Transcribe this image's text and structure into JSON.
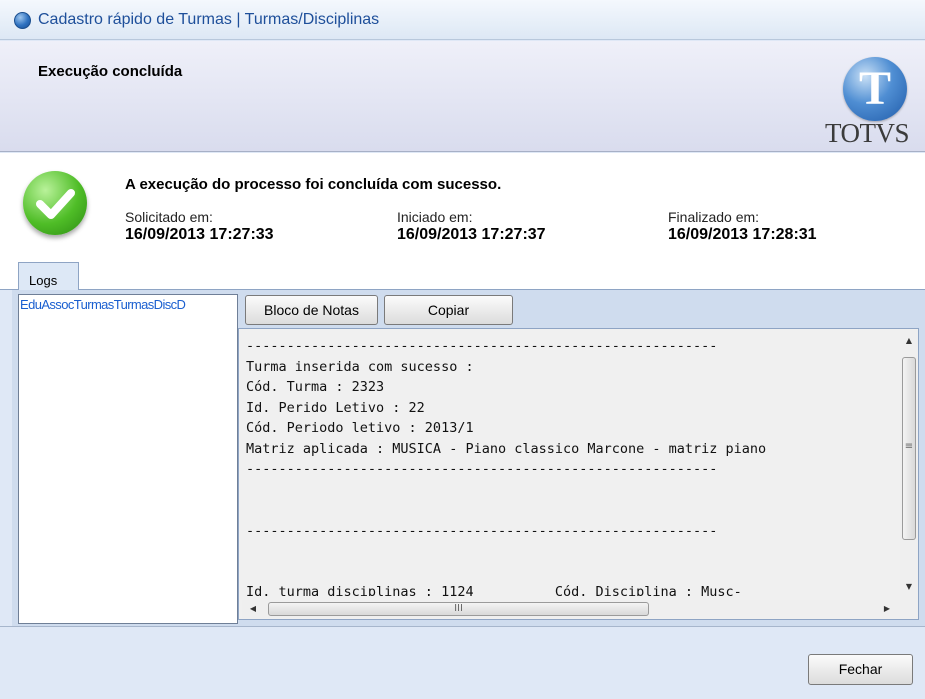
{
  "window": {
    "title": "Cadastro rápido de Turmas | Turmas/Disciplinas"
  },
  "header": {
    "title": "Execução concluída",
    "logo_text": "TOTVS",
    "logo_letter": "T"
  },
  "status": {
    "message": "A execução do processo foi concluída com sucesso.",
    "requested_label": "Solicitado em:",
    "requested_value": "16/09/2013 17:27:33",
    "started_label": "Iniciado em:",
    "started_value": "16/09/2013 17:27:37",
    "finished_label": "Finalizado em:",
    "finished_value": "16/09/2013 17:28:31"
  },
  "tabs": [
    {
      "label": "Logs"
    }
  ],
  "log_list": {
    "items": [
      "EduAssocTurmasTurmasDiscD"
    ]
  },
  "toolbar": {
    "notepad_label": "Bloco de Notas",
    "copy_label": "Copiar"
  },
  "log": {
    "text": "----------------------------------------------------------\nTurma inserida com sucesso :\nCód. Turma : 2323\nId. Perido Letivo : 22\nCód. Periodo letivo : 2013/1\nMatriz aplicada : MUSICA - Piano classico Marcone - matriz piano\n----------------------------------------------------------\n\n\n----------------------------------------------------------\n\n\nId. turma disciplinas : 1124          Cód. Disciplina : Musc-"
  },
  "scrollbar": {
    "up": "▲",
    "down": "▼",
    "left": "◀",
    "right": "▶",
    "v_grip": "≡",
    "h_grip": "III"
  },
  "footer": {
    "close_label": "Fechar"
  },
  "colors": {
    "title_text": "#1e4f9a",
    "list_selected_text": "#1a5fd0",
    "success_green": "#4fbd27"
  },
  "icons": {
    "title": "globe-icon",
    "status": "check-success-icon",
    "logo": "totvs-globe-logo"
  }
}
